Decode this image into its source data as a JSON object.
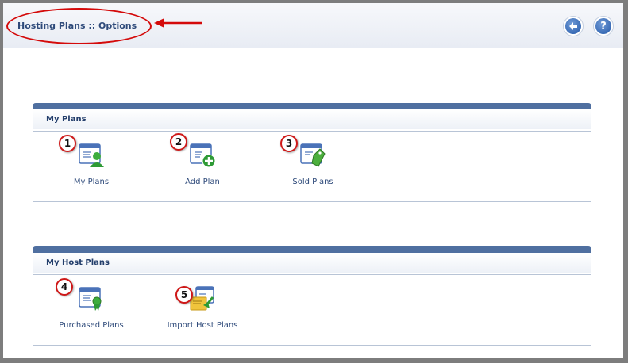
{
  "header": {
    "title": "Hosting Plans :: Options",
    "back_icon": "back-arrow-icon",
    "help_icon": "help-question-icon",
    "help_glyph": "?"
  },
  "sections": [
    {
      "title": "My Plans",
      "items": [
        {
          "badge": "1",
          "label": "My Plans",
          "icon": "user-plans-icon"
        },
        {
          "badge": "2",
          "label": "Add Plan",
          "icon": "add-plan-icon"
        },
        {
          "badge": "3",
          "label": "Sold Plans",
          "icon": "sold-plans-tag-icon"
        }
      ]
    },
    {
      "title": "My Host Plans",
      "items": [
        {
          "badge": "4",
          "label": "Purchased Plans",
          "icon": "purchased-plans-ribbon-icon"
        },
        {
          "badge": "5",
          "label": "Import Host Plans",
          "icon": "import-host-plans-icon"
        }
      ]
    }
  ],
  "colors": {
    "accent_blue": "#4f6fa0",
    "text_blue": "#2e4a7a",
    "annotation_red": "#d40a0a"
  }
}
